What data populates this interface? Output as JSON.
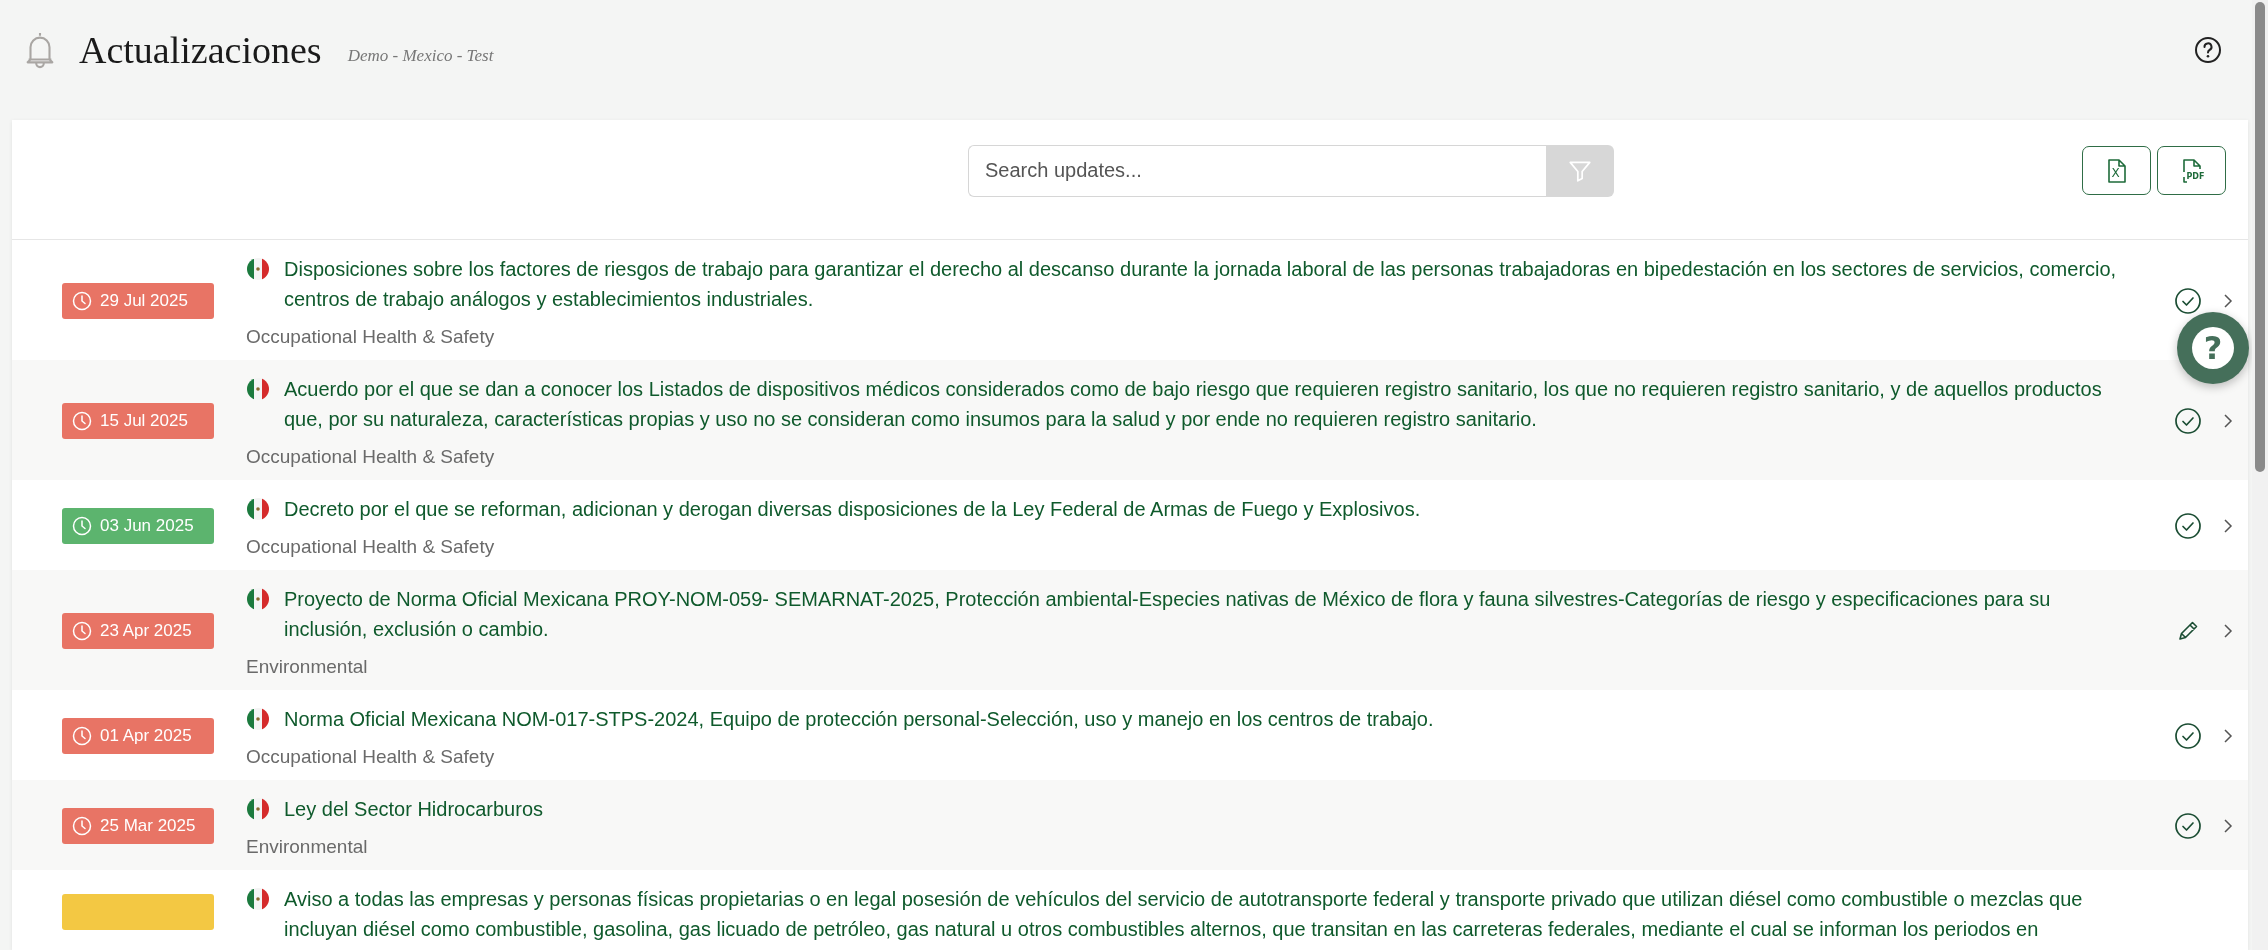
{
  "header": {
    "title": "Actualizaciones",
    "subtitle": "Demo - Mexico - Test"
  },
  "toolbar": {
    "search": {
      "placeholder": "Search updates..."
    },
    "exports": [
      {
        "kind": "excel",
        "label": "X"
      },
      {
        "kind": "pdf",
        "label": "PDF"
      }
    ]
  },
  "updates": [
    {
      "date": "29 Jul 2025",
      "color": "#e87465",
      "title": "Disposiciones sobre los factores de riesgos de trabajo para garantizar el derecho al descanso durante la jornada laboral de las personas trabajadoras en bipedestación en los sectores de servicios, comercio, centros de trabajo análogos y establecimientos industriales.",
      "category": "Occupational Health & Safety",
      "kind": "check"
    },
    {
      "date": "15 Jul 2025",
      "color": "#e87465",
      "title": "Acuerdo por el que se dan a conocer los Listados de dispositivos médicos considerados como de bajo riesgo que requieren registro sanitario, los que no requieren registro sanitario, y de aquellos productos que, por su naturaleza, características propias y uso no se consideran como insumos para la salud y por ende no requieren registro sanitario.",
      "category": "Occupational Health & Safety",
      "kind": "check"
    },
    {
      "date": "03 Jun 2025",
      "color": "#5cb46e",
      "title": "Decreto por el que se reforman, adicionan y derogan diversas disposiciones de la Ley Federal de Armas de Fuego y Explosivos.",
      "category": "Occupational Health & Safety",
      "kind": "check"
    },
    {
      "date": "23 Apr 2025",
      "color": "#e87465",
      "title": "Proyecto de Norma Oficial Mexicana PROY-NOM-059- SEMARNAT-2025, Protección ambiental-Especies nativas de México de flora y fauna silvestres-Categorías de riesgo y especificaciones para su inclusión, exclusión o cambio.",
      "category": "Environmental",
      "kind": "edit"
    },
    {
      "date": "01 Apr 2025",
      "color": "#e87465",
      "title": "Norma Oficial Mexicana NOM-017-STPS-2024, Equipo de protección personal-Selección, uso y manejo en los centros de trabajo.",
      "category": "Occupational Health & Safety",
      "kind": "check"
    },
    {
      "date": "25 Mar 2025",
      "color": "#e87465",
      "title": "Ley del Sector Hidrocarburos",
      "category": "Environmental",
      "kind": "check"
    },
    {
      "color": "#f3c843",
      "title": "Aviso a todas las empresas y personas físicas propietarias o en legal posesión de vehículos del servicio de autotransporte federal y transporte privado que utilizan diésel como combustible o mezclas que incluyan diésel como combustible, gasolina, gas licuado de petróleo, gas natural u otros combustibles alternos, que transitan en las carreteras federales, mediante el cual se informan los periodos en"
    }
  ],
  "help_button": {
    "label": "?"
  }
}
